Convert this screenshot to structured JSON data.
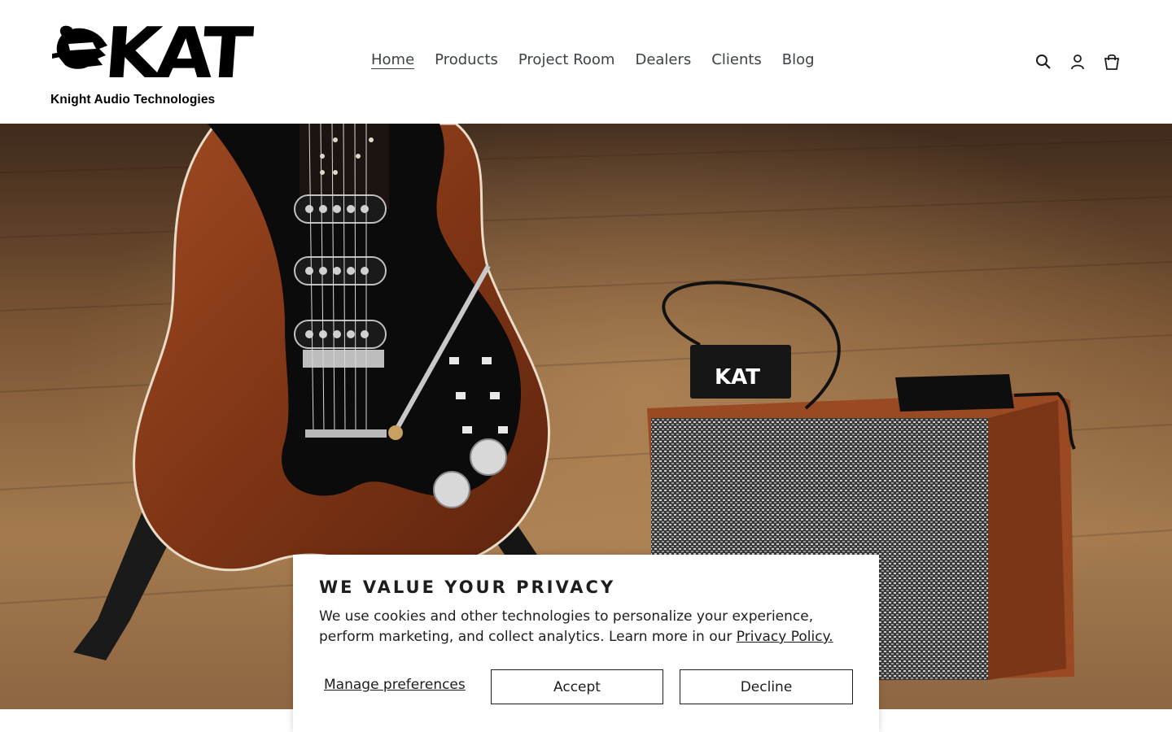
{
  "brand": {
    "logo_text": "KAT",
    "tagline": "Knight Audio Technologies"
  },
  "nav": {
    "items": [
      {
        "label": "Home",
        "active": true
      },
      {
        "label": "Products",
        "active": false
      },
      {
        "label": "Project Room",
        "active": false
      },
      {
        "label": "Dealers",
        "active": false
      },
      {
        "label": "Clients",
        "active": false
      },
      {
        "label": "Blog",
        "active": false
      }
    ]
  },
  "header_icons": [
    "search-icon",
    "account-icon",
    "cart-icon"
  ],
  "hero": {
    "amp_box_logo": "KAT"
  },
  "cookie": {
    "title": "WE VALUE YOUR PRIVACY",
    "text": "We use cookies and other technologies to personalize your experience, perform marketing, and collect analytics. Learn more in our ",
    "link": "Privacy Policy.",
    "manage": "Manage preferences",
    "accept": "Accept",
    "decline": "Decline"
  },
  "colors": {
    "text": "#1c1d1d",
    "nav_text": "#3d4246",
    "guitar_body": "#8a3a1a",
    "pickguard": "#0b0b0b",
    "floor": "#8a6340"
  }
}
